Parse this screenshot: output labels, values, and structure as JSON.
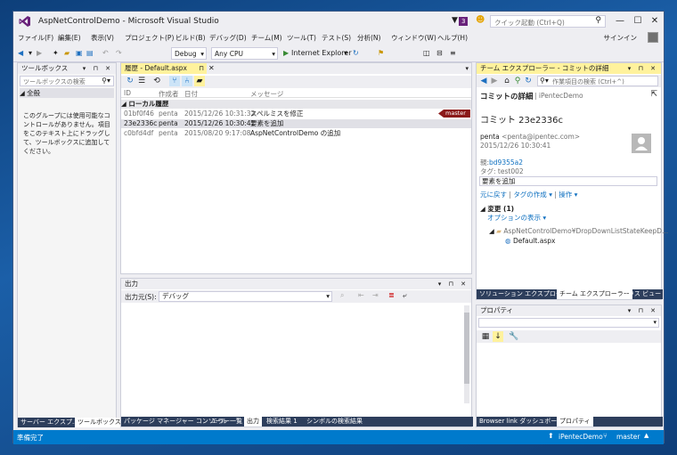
{
  "window": {
    "title": "AspNetControlDemo - Microsoft Visual Studio",
    "notification_count": "3",
    "quick_launch_placeholder": "クイック起動 (Ctrl+Q)"
  },
  "menu": {
    "items": [
      "ファイル(F)",
      "編集(E)",
      "表示(V)",
      "プロジェクト(P)",
      "ビルド(B)",
      "デバッグ(D)",
      "チーム(M)",
      "ツール(T)",
      "テスト(S)",
      "分析(N)",
      "ウィンドウ(W)",
      "ヘルプ(H)"
    ],
    "signin": "サインイン"
  },
  "toolbar": {
    "config": "Debug",
    "platform": "Any CPU",
    "run_target": "Internet Explorer"
  },
  "toolbox": {
    "title": "ツールボックス",
    "search_placeholder": "ツールボックスの検索",
    "group": "全般",
    "empty_message": "このグループには使用可能なコントロールがありません。項目をこのテキスト上にドラッグして、ツールボックスに追加してください。",
    "bottom_tabs": [
      "サーバー エクスプ...",
      "ツールボックス"
    ]
  },
  "history": {
    "tab_label": "履歴 - Default.aspx",
    "columns": [
      "ID",
      "作成者",
      "日付",
      "メッセージ"
    ],
    "group": "ローカル履歴",
    "rows": [
      {
        "id": "01bf0f46",
        "author": "penta",
        "date": "2015/12/26 10:31:32",
        "message": "スペルミスを修正",
        "tag": "master"
      },
      {
        "id": "23e2336c",
        "author": "penta",
        "date": "2015/12/26 10:30:41",
        "message": "要素を追加",
        "tag": ""
      },
      {
        "id": "c0bfd4df",
        "author": "penta",
        "date": "2015/08/20 9:17:08",
        "message": "AspNetControlDemo の追加",
        "tag": ""
      }
    ]
  },
  "output": {
    "title": "出力",
    "source_label": "出力元(S):",
    "source_value": "デバッグ",
    "bottom_tabs": [
      "パッケージ マネージャー コンソール",
      "エラー一覧",
      "出力",
      "検索結果 1",
      "シンボルの検索結果"
    ]
  },
  "team_explorer": {
    "title": "チーム エクスプローラー - コミットの詳細",
    "search_placeholder": "作業項目の検索 (Ctrl+^)",
    "section_title": "コミットの詳細",
    "site": "iPentecDemo",
    "commit_title": "コミット 23e2336c",
    "author": "penta",
    "email": "<penta@ipentec.com>",
    "date": "2015/12/26 10:30:41",
    "parent_label": "親:",
    "parent": "bd9355a2",
    "tag": "タグ: test002",
    "message": "要素を追加",
    "actions": [
      "元に戻す",
      "タグの作成 ▾",
      "操作 ▾"
    ],
    "changes_label": "変更 (1)",
    "options_link": "オプションの表示 ▾",
    "tree_folder": "AspNetControlDemo¥DropDownListStateKeepD...",
    "tree_file": "Default.aspx",
    "bottom_tabs": [
      "ソリューション エクスプローラー",
      "チーム エクスプローラー",
      "クラス ビュー"
    ]
  },
  "properties": {
    "title": "プロパティ",
    "bottom_tabs": [
      "Browser link ダッシュボード",
      "プロパティ"
    ]
  },
  "statusbar": {
    "text": "準備完了",
    "repo": "iPentecDemo",
    "branch": "master"
  },
  "colors": {
    "accent": "#007acc",
    "active_header": "#fff29d",
    "tag_bg": "#8b1a1a",
    "vs_purple": "#68217a"
  }
}
